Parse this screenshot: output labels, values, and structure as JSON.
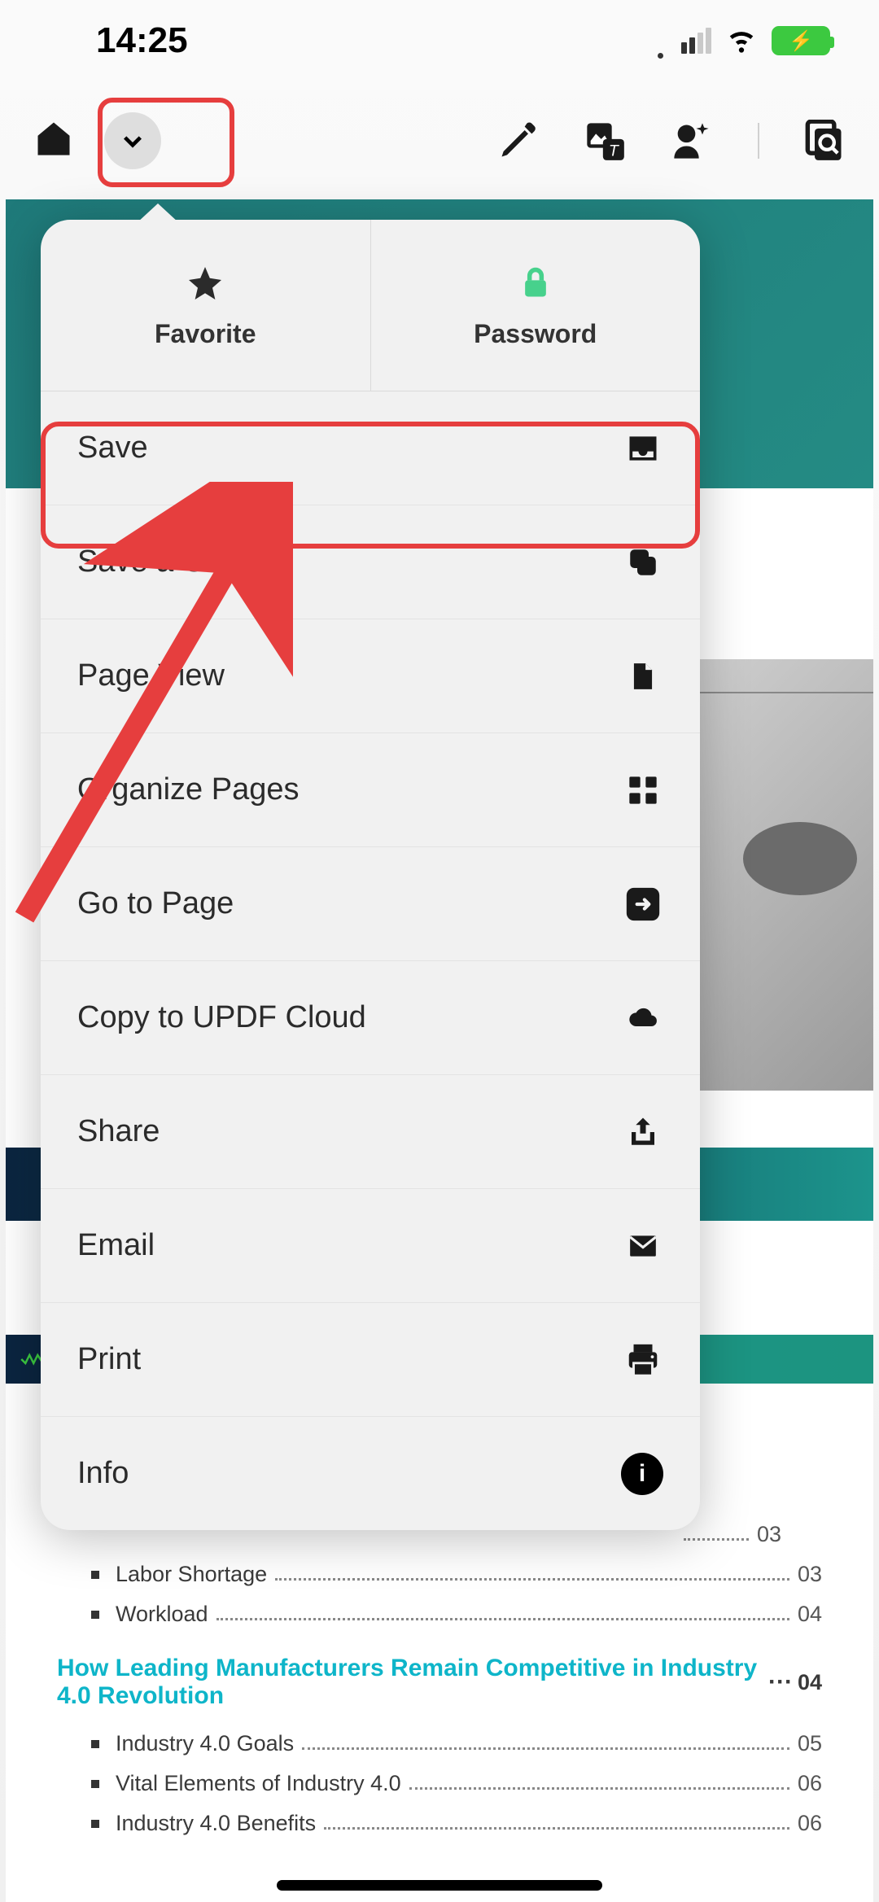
{
  "status": {
    "time": "14:25"
  },
  "popover": {
    "tabs": {
      "favorite": "Favorite",
      "password": "Password"
    },
    "items": [
      {
        "label": "Save",
        "icon": "inbox-icon"
      },
      {
        "label": "Save a Copy",
        "icon": "copy-icon"
      },
      {
        "label": "Page View",
        "icon": "page-icon"
      },
      {
        "label": "Organize Pages",
        "icon": "grid-icon"
      },
      {
        "label": "Go to Page",
        "icon": "goto-icon"
      },
      {
        "label": "Copy to UPDF Cloud",
        "icon": "cloud-icon"
      },
      {
        "label": "Share",
        "icon": "share-icon"
      },
      {
        "label": "Email",
        "icon": "mail-icon"
      },
      {
        "label": "Print",
        "icon": "print-icon"
      },
      {
        "label": "Info",
        "icon": "info-icon"
      }
    ]
  },
  "doc": {
    "toc": {
      "items_a": [
        {
          "label": "",
          "page": "03"
        },
        {
          "label": "Labor Shortage",
          "page": "03"
        },
        {
          "label": "Workload",
          "page": "04"
        }
      ],
      "heading": {
        "label": "How Leading Manufacturers Remain Competitive in Industry 4.0 Revolution",
        "page": "04"
      },
      "items_b": [
        {
          "label": "Industry 4.0 Goals",
          "page": "05"
        },
        {
          "label": "Vital Elements of Industry 4.0",
          "page": "06"
        },
        {
          "label": "Industry 4.0 Benefits",
          "page": "06"
        }
      ]
    }
  },
  "annotations": {
    "highlight_dropdown": true,
    "highlight_save": true,
    "arrow_to_save": true
  }
}
